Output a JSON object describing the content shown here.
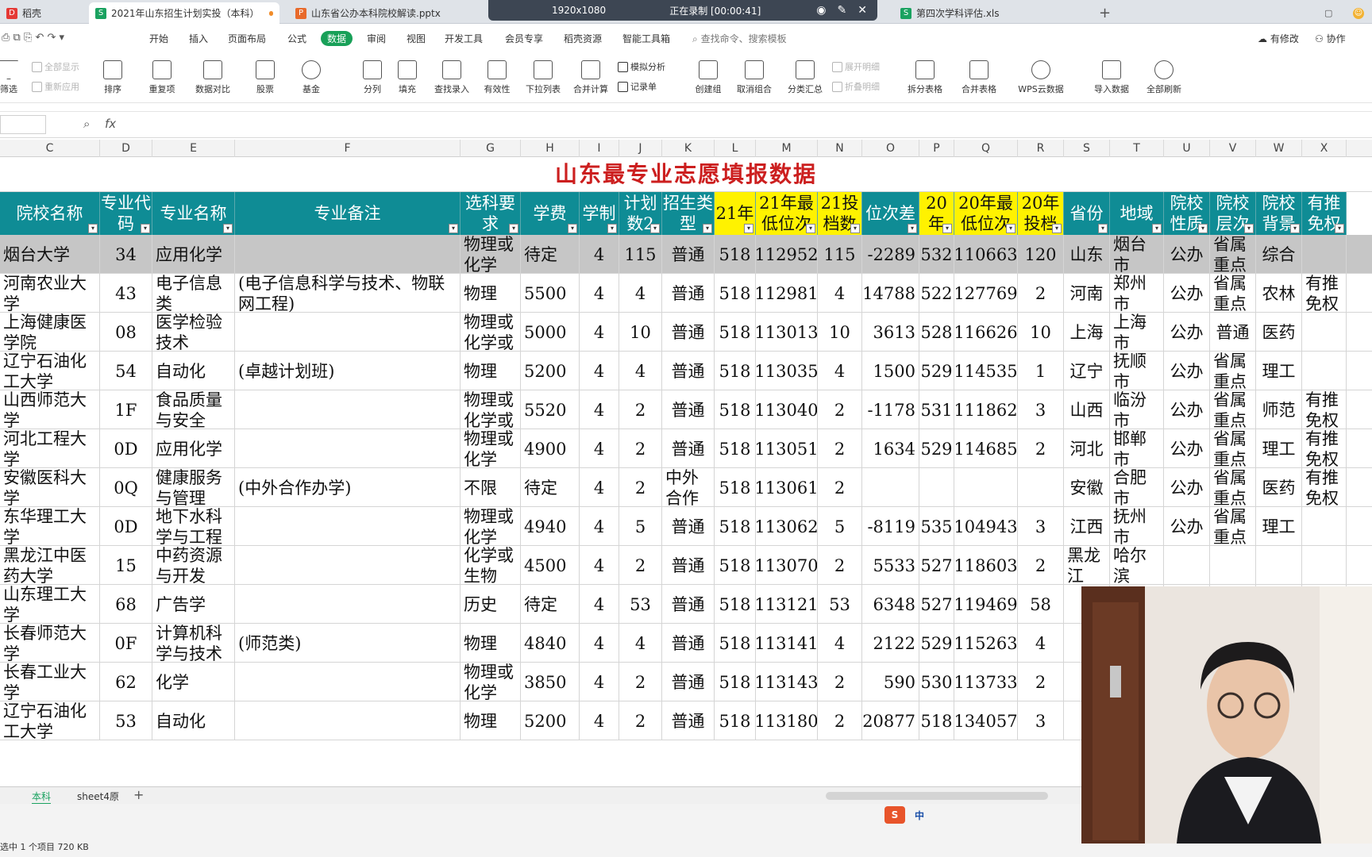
{
  "tabs": [
    {
      "label": "稻壳",
      "icon_color": "#e53935"
    },
    {
      "label": "2021年山东招生计划实投（本科）",
      "icon_color": "#1aa260"
    },
    {
      "label": "山东省公办本科院校解读.pptx",
      "icon_color": "#e86a2b"
    },
    {
      "label": "",
      "icon_color": "#1a73e8"
    },
    {
      "label": "第四次学科评估.xls",
      "icon_color": "#1aa260"
    }
  ],
  "recorder": {
    "resolution": "1920x1080",
    "status": "正在录制 [00:00:41]"
  },
  "menu": [
    "开始",
    "插入",
    "页面布局",
    "公式",
    "数据",
    "审阅",
    "视图",
    "开发工具",
    "会员专享",
    "稻壳资源",
    "智能工具箱"
  ],
  "menu_active": "数据",
  "search_placeholder": "查找命令、搜索模板",
  "menu_right": [
    "有修改",
    "协作"
  ],
  "ribbon": {
    "filter": "筛选",
    "show_all": "全部显示",
    "reapply": "重新应用",
    "sort": "排序",
    "repeat": "重复项",
    "compare": "数据对比",
    "stock": "股票",
    "fund": "基金",
    "split": "分列",
    "fill": "填充",
    "find_input": "查找录入",
    "validity": "有效性",
    "dropdown": "下拉列表",
    "merge_calc": "合并计算",
    "sim_analysis": "模拟分析",
    "record_list": "记录单",
    "create_group": "创建组",
    "ungroup": "取消组合",
    "subtotal": "分类汇总",
    "expand": "展开明细",
    "collapse": "折叠明细",
    "split_table": "拆分表格",
    "merge_table": "合并表格",
    "wps_cloud": "WPS云数据",
    "import": "导入数据",
    "refresh_all": "全部刷新"
  },
  "formula": {
    "fx": "fx"
  },
  "columns": [
    "C",
    "D",
    "E",
    "F",
    "G",
    "H",
    "I",
    "J",
    "K",
    "L",
    "M",
    "N",
    "O",
    "P",
    "Q",
    "R",
    "S",
    "T",
    "U",
    "V",
    "W",
    "X"
  ],
  "sheet_title": "山东最专业志愿填报数据",
  "headers": [
    "院校名称",
    "专业代码",
    "专业名称",
    "专业备注",
    "选科要求",
    "学费",
    "学制",
    "计划数2",
    "招生类型",
    "21年",
    "21年最低位次",
    "21投档数",
    "位次差",
    "20年",
    "20年最低位次",
    "20年投档",
    "省份",
    "地域",
    "院校性质",
    "院校层次",
    "院校背景",
    "有推免权"
  ],
  "rows": [
    [
      "烟台大学",
      "34",
      "应用化学",
      "",
      "物理或化学",
      "待定",
      "4",
      "115",
      "普通",
      "518",
      "112952",
      "115",
      "-2289",
      "532",
      "110663",
      "120",
      "山东",
      "烟台市",
      "公办",
      "省属重点",
      "综合",
      ""
    ],
    [
      "河南农业大学",
      "43",
      "电子信息类",
      "(电子信息科学与技术、物联网工程)",
      "物理",
      "5500",
      "4",
      "4",
      "普通",
      "518",
      "112981",
      "4",
      "14788",
      "522",
      "127769",
      "2",
      "河南",
      "郑州市",
      "公办",
      "省属重点",
      "农林",
      "有推免权"
    ],
    [
      "上海健康医学院",
      "08",
      "医学检验技术",
      "",
      "物理或化学或",
      "5000",
      "4",
      "10",
      "普通",
      "518",
      "113013",
      "10",
      "3613",
      "528",
      "116626",
      "10",
      "上海",
      "上海市",
      "公办",
      "普通",
      "医药",
      ""
    ],
    [
      "辽宁石油化工大学",
      "54",
      "自动化",
      "(卓越计划班)",
      "物理",
      "5200",
      "4",
      "4",
      "普通",
      "518",
      "113035",
      "4",
      "1500",
      "529",
      "114535",
      "1",
      "辽宁",
      "抚顺市",
      "公办",
      "省属重点",
      "理工",
      ""
    ],
    [
      "山西师范大学",
      "1F",
      "食品质量与安全",
      "",
      "物理或化学或",
      "5520",
      "4",
      "2",
      "普通",
      "518",
      "113040",
      "2",
      "-1178",
      "531",
      "111862",
      "3",
      "山西",
      "临汾市",
      "公办",
      "省属重点",
      "师范",
      "有推免权"
    ],
    [
      "河北工程大学",
      "0D",
      "应用化学",
      "",
      "物理或化学",
      "4900",
      "4",
      "2",
      "普通",
      "518",
      "113051",
      "2",
      "1634",
      "529",
      "114685",
      "2",
      "河北",
      "邯郸市",
      "公办",
      "省属重点",
      "理工",
      "有推免权"
    ],
    [
      "安徽医科大学",
      "0Q",
      "健康服务与管理",
      "(中外合作办学)",
      "不限",
      "待定",
      "4",
      "2",
      "中外合作",
      "518",
      "113061",
      "2",
      "",
      "",
      "",
      "",
      "安徽",
      "合肥市",
      "公办",
      "省属重点",
      "医药",
      "有推免权"
    ],
    [
      "东华理工大学",
      "0D",
      "地下水科学与工程",
      "",
      "物理或化学",
      "4940",
      "4",
      "5",
      "普通",
      "518",
      "113062",
      "5",
      "-8119",
      "535",
      "104943",
      "3",
      "江西",
      "抚州市",
      "公办",
      "省属重点",
      "理工",
      ""
    ],
    [
      "黑龙江中医药大学",
      "15",
      "中药资源与开发",
      "",
      "化学或生物",
      "4500",
      "4",
      "2",
      "普通",
      "518",
      "113070",
      "2",
      "5533",
      "527",
      "118603",
      "2",
      "黑龙江",
      "哈尔滨",
      "",
      "",
      "",
      ""
    ],
    [
      "山东理工大学",
      "68",
      "广告学",
      "",
      "历史",
      "待定",
      "4",
      "53",
      "普通",
      "518",
      "113121",
      "53",
      "6348",
      "527",
      "119469",
      "58",
      "",
      "",
      "",
      "",
      "",
      ""
    ],
    [
      "长春师范大学",
      "0F",
      "计算机科学与技术",
      "(师范类)",
      "物理",
      "4840",
      "4",
      "4",
      "普通",
      "518",
      "113141",
      "4",
      "2122",
      "529",
      "115263",
      "4",
      "",
      "",
      "",
      "",
      "",
      ""
    ],
    [
      "长春工业大学",
      "62",
      "化学",
      "",
      "物理或化学",
      "3850",
      "4",
      "2",
      "普通",
      "518",
      "113143",
      "2",
      "590",
      "530",
      "113733",
      "2",
      "",
      "",
      "",
      "",
      "",
      ""
    ],
    [
      "辽宁石油化工大学",
      "53",
      "自动化",
      "",
      "物理",
      "5200",
      "4",
      "2",
      "普通",
      "518",
      "113180",
      "2",
      "20877",
      "518",
      "134057",
      "3",
      "",
      "",
      "",
      "",
      "",
      ""
    ]
  ],
  "sheet_tabs": [
    "本科",
    "sheet4原"
  ],
  "status": "选中 1 个项目  720 KB",
  "ime": "中"
}
